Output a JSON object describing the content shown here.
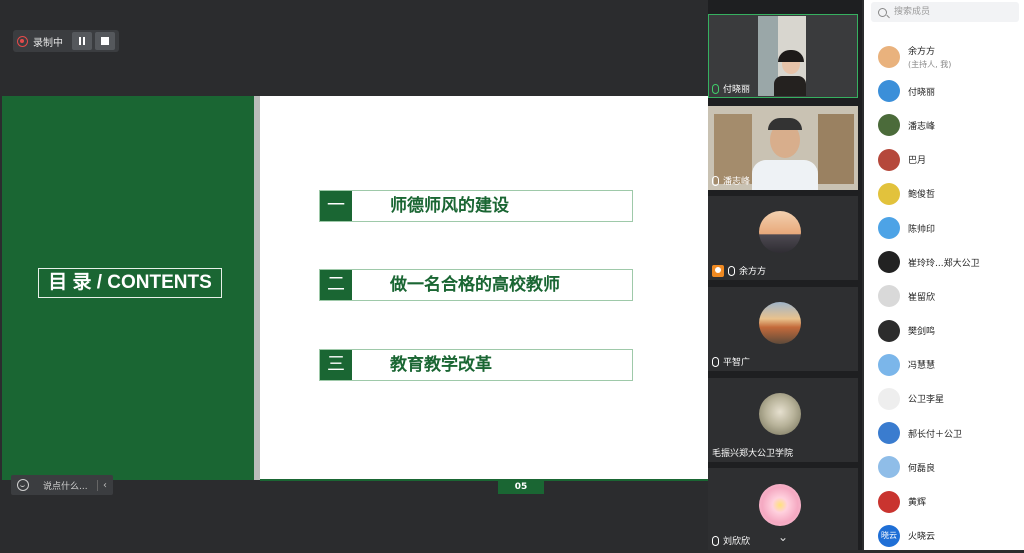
{
  "recording": {
    "label": "录制中"
  },
  "slide": {
    "contents_title": "目 录 / CONTENTS",
    "toc": [
      {
        "num": "一",
        "text": "师德师风的建设"
      },
      {
        "num": "二",
        "text": "做一名合格的高校教师"
      },
      {
        "num": "三",
        "text": "教育教学改革"
      }
    ],
    "page_number": "05"
  },
  "chat": {
    "placeholder": "说点什么..."
  },
  "video_tiles": [
    {
      "name": "付晓丽",
      "speaking": true
    },
    {
      "name": "潘志峰",
      "speaking": false
    },
    {
      "name": "余方方",
      "host": true
    },
    {
      "name": "平智广"
    },
    {
      "name": "毛振兴郑大公卫学院"
    },
    {
      "name": "刘欣欣"
    }
  ],
  "members": {
    "search_placeholder": "搜索成员",
    "list": [
      {
        "name": "余方方",
        "sub": "(主持人, 我)",
        "avatar_color": "#e9b27d"
      },
      {
        "name": "付晓丽",
        "avatar_color": "#3b8fd9"
      },
      {
        "name": "潘志峰",
        "avatar_color": "#4b6b3a"
      },
      {
        "name": "巴月",
        "avatar_color": "#b5483b"
      },
      {
        "name": "鲍俊哲",
        "avatar_color": "#e2c23c"
      },
      {
        "name": "陈帅印",
        "avatar_color": "#4da3e6"
      },
      {
        "name": "崔玲玲...郑大公卫",
        "avatar_color": "#222222"
      },
      {
        "name": "崔留欣",
        "avatar_color": "#d9d9d9"
      },
      {
        "name": "樊剑鸣",
        "avatar_color": "#2c2c2c"
      },
      {
        "name": "冯慧慧",
        "avatar_color": "#7bb6ea"
      },
      {
        "name": "公卫李星",
        "avatar_color": "#eeeeee"
      },
      {
        "name": "郝长付＋公卫",
        "avatar_color": "#3a7ccf"
      },
      {
        "name": "何磊良",
        "avatar_color": "#8fbde8"
      },
      {
        "name": "黄辉",
        "avatar_color": "#c9342f"
      },
      {
        "name": "火晓云",
        "avatar_text": "晓云",
        "avatar_color": "#1f6fd6"
      }
    ]
  }
}
